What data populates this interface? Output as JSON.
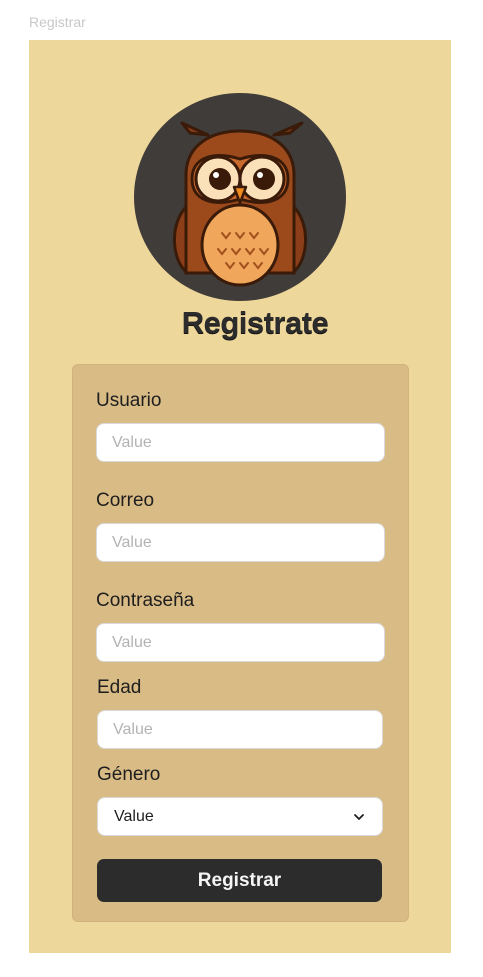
{
  "frame": {
    "label": "Registrar"
  },
  "page": {
    "title": "Registrate"
  },
  "form": {
    "fields": [
      {
        "label": "Usuario",
        "placeholder": "Value"
      },
      {
        "label": "Correo",
        "placeholder": "Value"
      },
      {
        "label": "Contraseña",
        "placeholder": "Value"
      },
      {
        "label": "Edad",
        "placeholder": "Value"
      }
    ],
    "gender": {
      "label": "Género",
      "value": "Value"
    },
    "submit_label": "Registrar"
  },
  "icons": {
    "avatar": "owl-mascot-icon",
    "select": "chevron-down-icon"
  },
  "colors": {
    "background": "#eed79b",
    "card": "#d9bb86",
    "button": "#2c2c2c",
    "avatar_bg": "#3f3c39"
  }
}
